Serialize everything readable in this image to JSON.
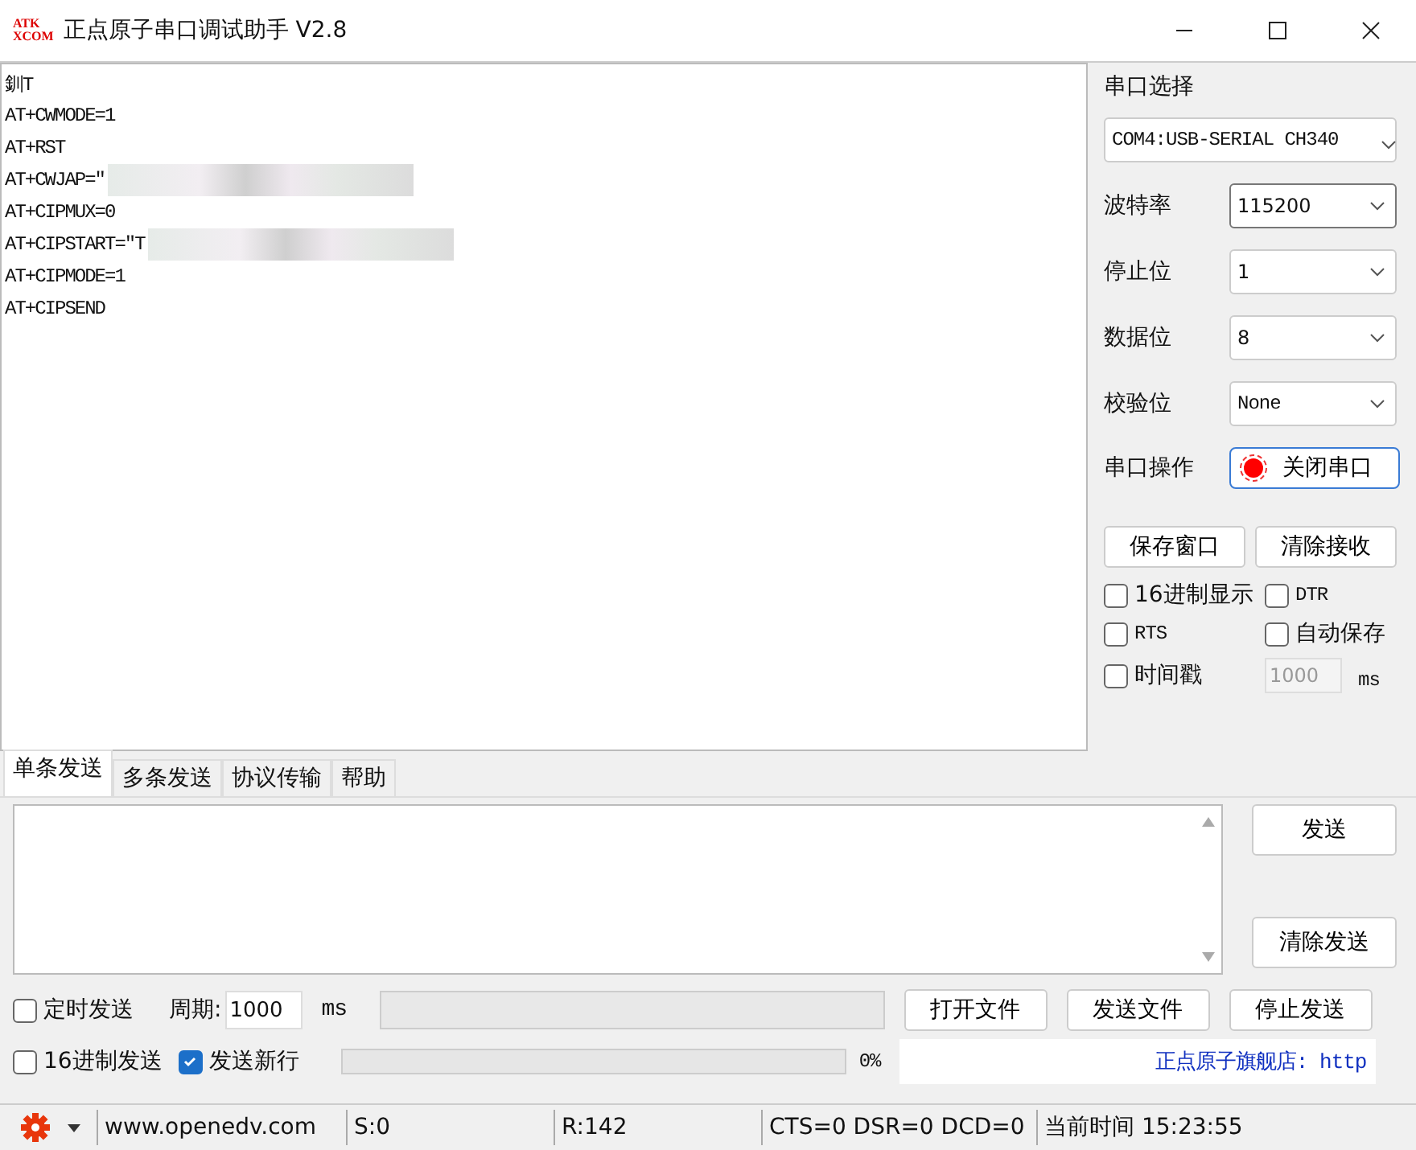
{
  "window": {
    "title": "正点原子串口调试助手 V2.8",
    "logo_top": "ATK",
    "logo_bottom": "XCOM"
  },
  "receive": {
    "lines": [
      {
        "text": "釧T",
        "redacted": false
      },
      {
        "text": "AT+CWMODE=1",
        "redacted": false
      },
      {
        "text": "AT+RST",
        "redacted": false
      },
      {
        "text": "AT+CWJAP=\"",
        "redacted": true
      },
      {
        "text": "AT+CIPMUX=0",
        "redacted": false
      },
      {
        "text": "AT+CIPSTART=\"T",
        "redacted": true
      },
      {
        "text": "AT+CIPMODE=1",
        "redacted": false
      },
      {
        "text": "AT+CIPSEND",
        "redacted": false
      }
    ]
  },
  "settings": {
    "port_label": "串口选择",
    "port_value": "COM4:USB-SERIAL CH340",
    "fields": [
      {
        "label": "波特率",
        "value": "115200",
        "focused": true
      },
      {
        "label": "停止位",
        "value": "1",
        "focused": false
      },
      {
        "label": "数据位",
        "value": "8",
        "focused": false
      },
      {
        "label": "校验位",
        "value": "None",
        "focused": false
      }
    ],
    "operation_label": "串口操作",
    "operation_button": {
      "label": "关闭串口",
      "open": true
    },
    "buttons": [
      "保存窗口",
      "清除接收"
    ],
    "options": [
      {
        "label": "16进制显示",
        "checked": false
      },
      {
        "label": "DTR",
        "checked": false
      },
      {
        "label": "RTS",
        "checked": false
      },
      {
        "label": "自动保存",
        "checked": false
      },
      {
        "label": "时间戳",
        "checked": false
      }
    ],
    "timestamp_ms": {
      "placeholder": "1000",
      "unit": "ms"
    }
  },
  "tabs": [
    {
      "label": "单条发送",
      "selected": true
    },
    {
      "label": "多条发送",
      "selected": false
    },
    {
      "label": "协议传输",
      "selected": false
    },
    {
      "label": "帮助",
      "selected": false
    }
  ],
  "send": {
    "buttons": [
      "发送",
      "清除发送"
    ],
    "timed_send": {
      "label": "定时发送",
      "checked": false
    },
    "period_label": "周期:",
    "period_value": "1000",
    "period_unit": "ms",
    "hex_send": {
      "label": "16进制发送",
      "checked": false
    },
    "newline": {
      "label": "发送新行",
      "checked": true
    },
    "progress": {
      "level": 0,
      "reading": "0%"
    },
    "file_buttons": [
      "打开文件",
      "发送文件",
      "停止发送"
    ],
    "link": "正点原子旗舰店: http"
  },
  "status_bar": {
    "url": "www.openedv.com",
    "sent": "S:0",
    "received": "R:142",
    "lines": "CTS=0 DSR=0 DCD=0",
    "time": "当前时间 15:23:55"
  }
}
